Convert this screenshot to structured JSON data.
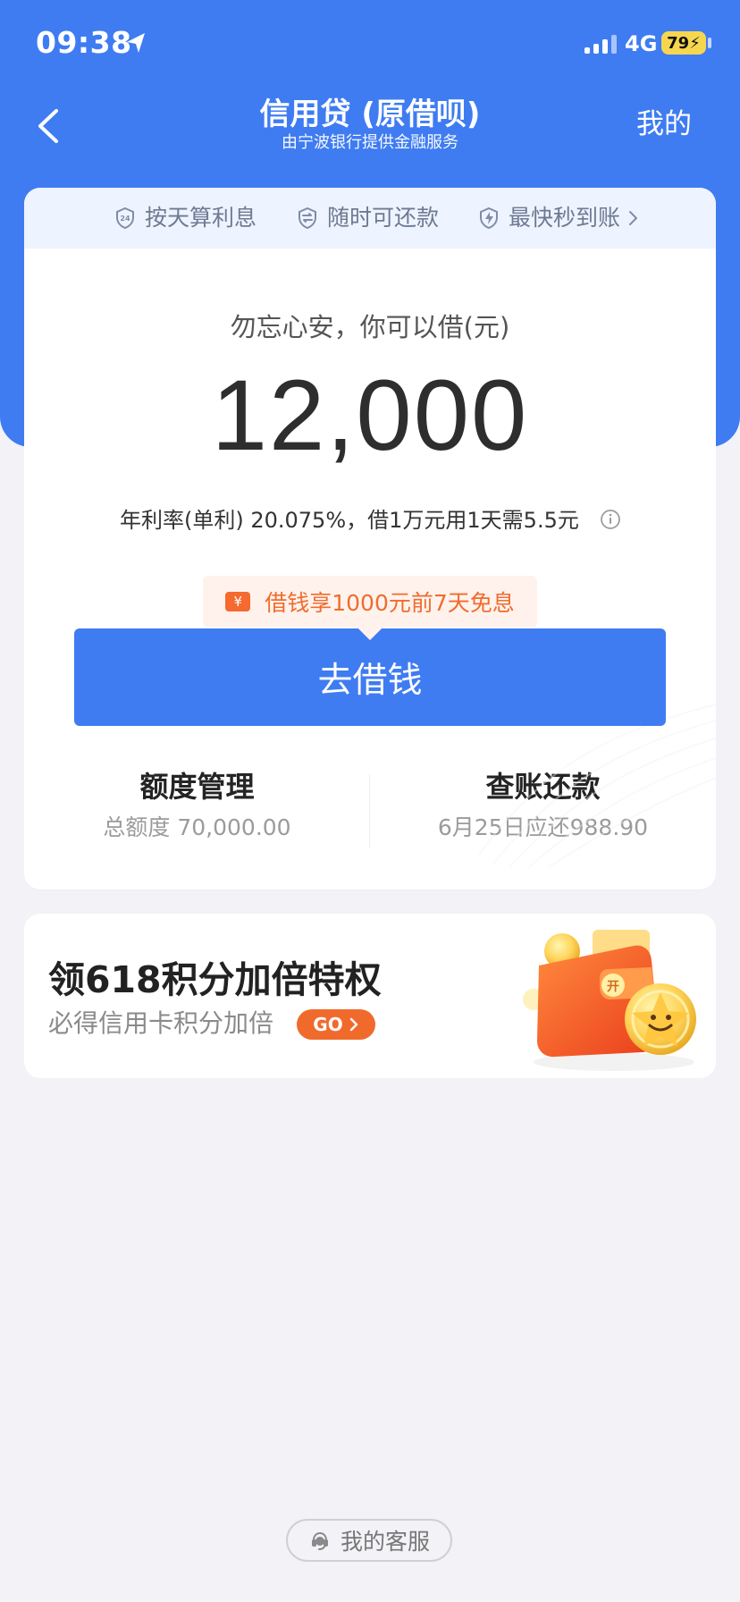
{
  "status_bar": {
    "time": "09:38",
    "network": "4G",
    "battery": "79",
    "location_icon": "location-arrow-icon",
    "signal_icon": "cellular-signal-icon"
  },
  "navigation": {
    "title": "信用贷 (原借呗)",
    "subtitle": "由宁波银行提供金融服务",
    "right_action": "我的",
    "back_icon": "back-chevron-icon"
  },
  "features": [
    {
      "label": "按天算利息",
      "icon": "daily-interest-icon"
    },
    {
      "label": "随时可还款",
      "icon": "exchange-icon"
    },
    {
      "label": "最快秒到账",
      "icon": "lightning-icon"
    }
  ],
  "loan": {
    "prompt": "勿忘心安，你可以借(元)",
    "amount": "12,000",
    "rate_text": "年利率(单利) 20.075%，借1万元用1天需5.5元",
    "promo": "借钱享1000元前7天免息",
    "promo_icon_text": "¥",
    "button_label": "去借钱"
  },
  "actions": [
    {
      "title": "额度管理",
      "subtitle": "总额度 70,000.00"
    },
    {
      "title": "查账还款",
      "subtitle": "6月25日应还988.90"
    }
  ],
  "banner": {
    "title": "领618积分加倍特权",
    "subtitle": "必得信用卡积分加倍",
    "button_label": "GO",
    "art_text": "开"
  },
  "footer": {
    "service_label": "我的客服"
  },
  "colors": {
    "brand_blue": "#3f7cf2",
    "orange": "#f06a2c",
    "background": "#f2f2f7"
  }
}
